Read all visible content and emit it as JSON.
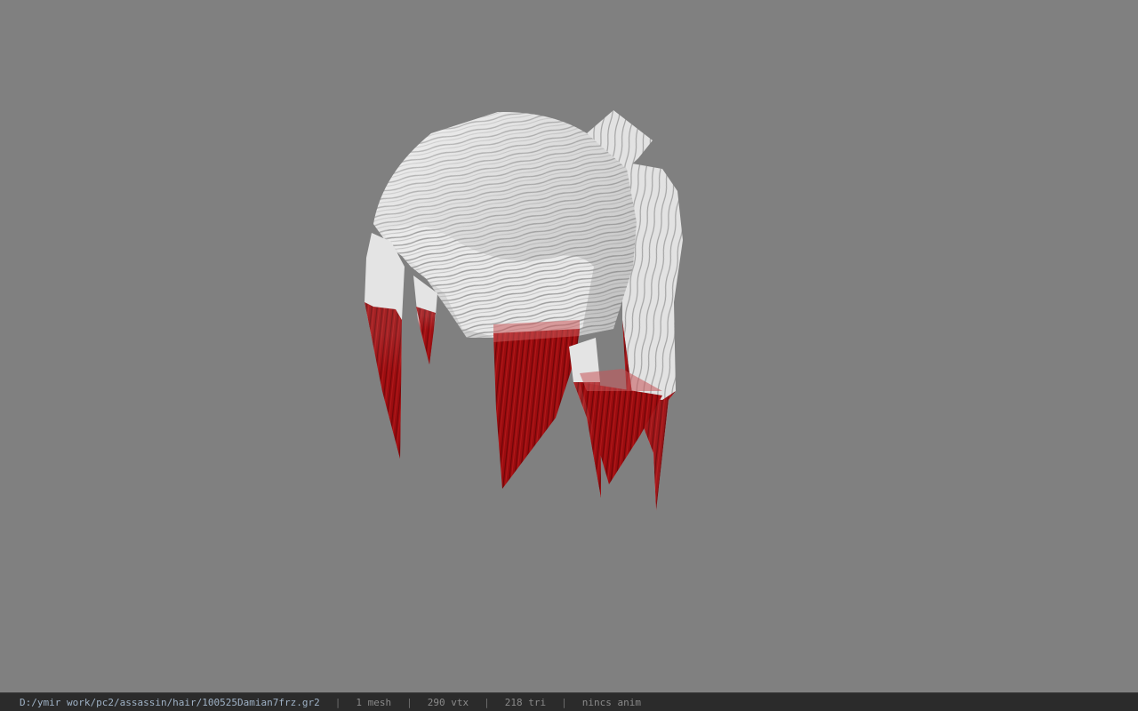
{
  "viewport": {
    "background": "#808080",
    "model": {
      "type": "hair-mesh",
      "base_color": "#e6e6e6",
      "tip_color": "#9a0d10"
    }
  },
  "statusbar": {
    "path": "D:/ymir work/pc2/assassin/hair/100525Damian7frz.gr2",
    "separator": "|",
    "mesh": "1 mesh",
    "vertices": "290 vtx",
    "triangles": "218 tri",
    "anim": "nincs anim"
  }
}
